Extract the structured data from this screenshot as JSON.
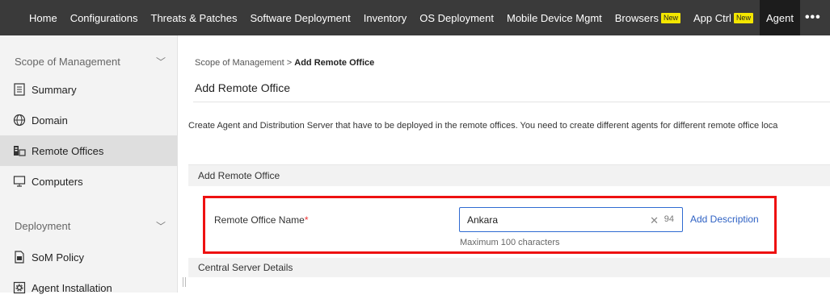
{
  "nav": {
    "items": [
      {
        "label": "Home"
      },
      {
        "label": "Configurations"
      },
      {
        "label": "Threats & Patches"
      },
      {
        "label": "Software Deployment"
      },
      {
        "label": "Inventory"
      },
      {
        "label": "OS Deployment"
      },
      {
        "label": "Mobile Device Mgmt"
      },
      {
        "label": "Browsers",
        "badge": "New"
      },
      {
        "label": "App Ctrl",
        "badge": "New"
      },
      {
        "label": "Agent"
      }
    ],
    "more": "•••"
  },
  "sidebar": {
    "section1": "Scope of Management",
    "items1": [
      {
        "label": "Summary",
        "icon": "summary-icon"
      },
      {
        "label": "Domain",
        "icon": "globe-icon"
      },
      {
        "label": "Remote Offices",
        "icon": "remote-offices-icon"
      },
      {
        "label": "Computers",
        "icon": "computer-icon"
      }
    ],
    "section2": "Deployment",
    "items2": [
      {
        "label": "SoM Policy",
        "icon": "policy-icon"
      },
      {
        "label": "Agent Installation",
        "icon": "agent-install-icon"
      }
    ]
  },
  "main": {
    "breadcrumb_parent": "Scope of Management",
    "breadcrumb_sep": ">",
    "breadcrumb_current": "Add Remote Office",
    "title": "Add Remote Office",
    "description": "Create Agent and Distribution Server that have to be deployed in the remote offices. You need to create different agents for different remote office loca",
    "panel_title": "Add Remote Office",
    "field_label": "Remote Office Name",
    "required_mark": "*",
    "field_value": "Ankara",
    "char_remaining": "94",
    "hint": "Maximum 100 characters",
    "add_description": "Add Description",
    "panel2_title": "Central Server Details"
  },
  "colors": {
    "accent": "#2f6bd1",
    "highlight": "#ee1111",
    "nav_bg": "#3a3a3a"
  }
}
